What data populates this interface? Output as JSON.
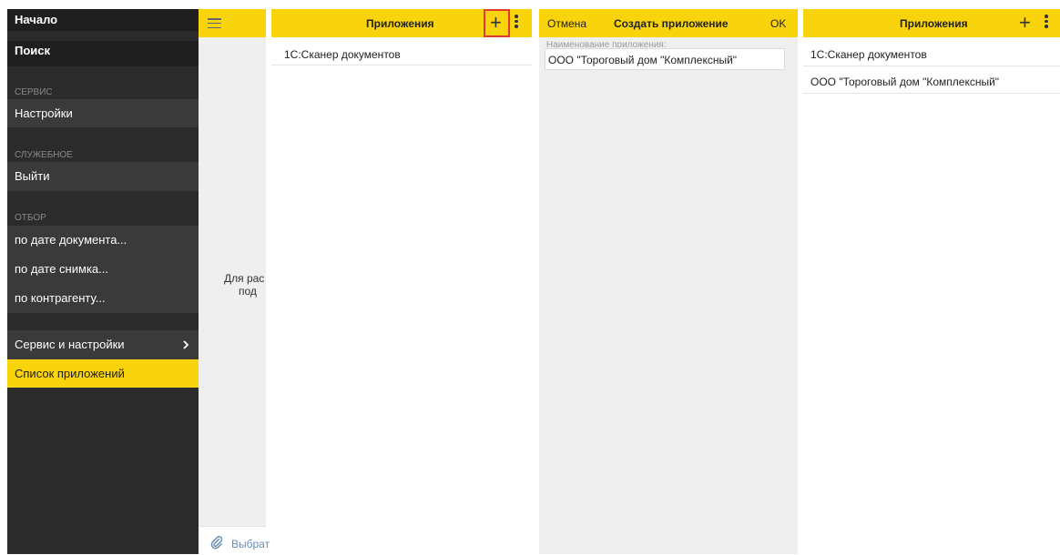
{
  "menu": {
    "start_label": "Начало",
    "search_label": "Поиск",
    "section_service": "СЕРВИС",
    "settings_label": "Настройки",
    "section_utility": "СЛУЖЕБНОЕ",
    "exit_label": "Выйти",
    "section_filter": "ОТБОР",
    "filter_by_doc_date": "по дате документа...",
    "filter_by_snapshot_date": "по дате снимка...",
    "filter_by_counterparty": "по контрагенту...",
    "service_settings_label": "Сервис и настройки",
    "app_list_label": "Список приложений"
  },
  "main_screen": {
    "hint_line1": "Для рас",
    "hint_line2": "под",
    "attach_label": "Выбрат"
  },
  "apps_panel": {
    "title": "Приложения",
    "add_icon": "+",
    "items": [
      "1С:Сканер документов"
    ]
  },
  "create_panel": {
    "cancel_label": "Отмена",
    "title": "Создать приложение",
    "ok_label": "OK",
    "name_label": "Наименование приложения:",
    "name_value": "ООО \"Тороговый дом \"Комплексный\""
  },
  "apps_panel_after": {
    "title": "Приложения",
    "add_icon": "+",
    "items": [
      "1С:Сканер документов",
      "ООО \"Тороговый дом \"Комплексный\""
    ]
  },
  "colors": {
    "accent_yellow": "#f9d30c",
    "menu_bg": "#2b2b2b",
    "highlight_red": "#e03a2f"
  }
}
